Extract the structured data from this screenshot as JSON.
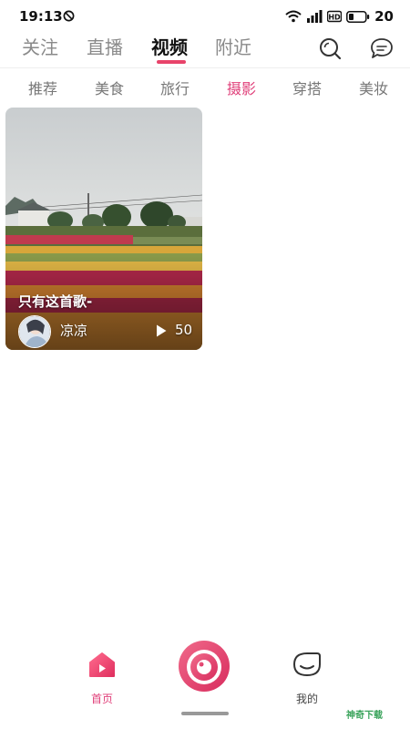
{
  "status": {
    "time": "19:13",
    "battery": "20"
  },
  "top_tabs": [
    {
      "label": "关注"
    },
    {
      "label": "直播"
    },
    {
      "label": "视频"
    },
    {
      "label": "附近"
    }
  ],
  "categories": [
    {
      "label": "推荐"
    },
    {
      "label": "美食"
    },
    {
      "label": "旅行"
    },
    {
      "label": "摄影"
    },
    {
      "label": "穿搭"
    },
    {
      "label": "美妆"
    }
  ],
  "active_category": "摄影",
  "active_tab": "视频",
  "video": {
    "title": "只有这首歌-",
    "author": "凉凉",
    "play_count": "50"
  },
  "bottom_nav": {
    "home_label": "首页",
    "me_label": "我的"
  },
  "icons": {
    "search": "search-icon",
    "message": "message-icon",
    "camera": "camera-icon",
    "home": "home-icon",
    "profile": "profile-icon"
  },
  "watermark": "神奇下载",
  "colors": {
    "accent": "#e0407a"
  }
}
